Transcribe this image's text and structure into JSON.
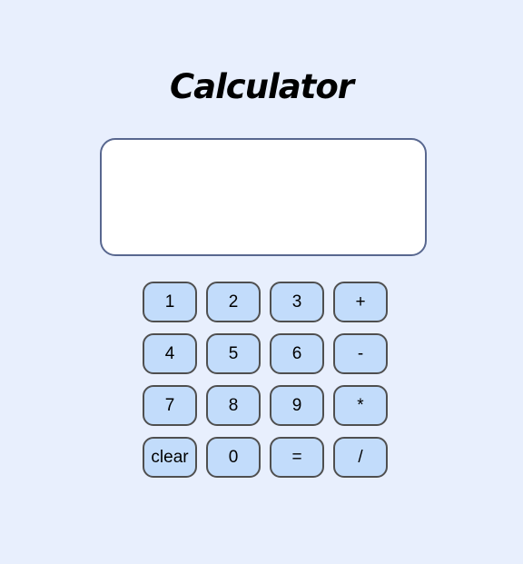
{
  "title": "Calculator",
  "display": {
    "value": ""
  },
  "keys": [
    "1",
    "2",
    "3",
    "+",
    "4",
    "5",
    "6",
    "-",
    "7",
    "8",
    "9",
    "*",
    "clear",
    "0",
    "=",
    "/"
  ],
  "colors": {
    "background": "#e8effd",
    "display_bg": "#ffffff",
    "display_border": "#58678f",
    "key_bg": "#c2dcfb",
    "key_border": "#4f4f4f"
  }
}
